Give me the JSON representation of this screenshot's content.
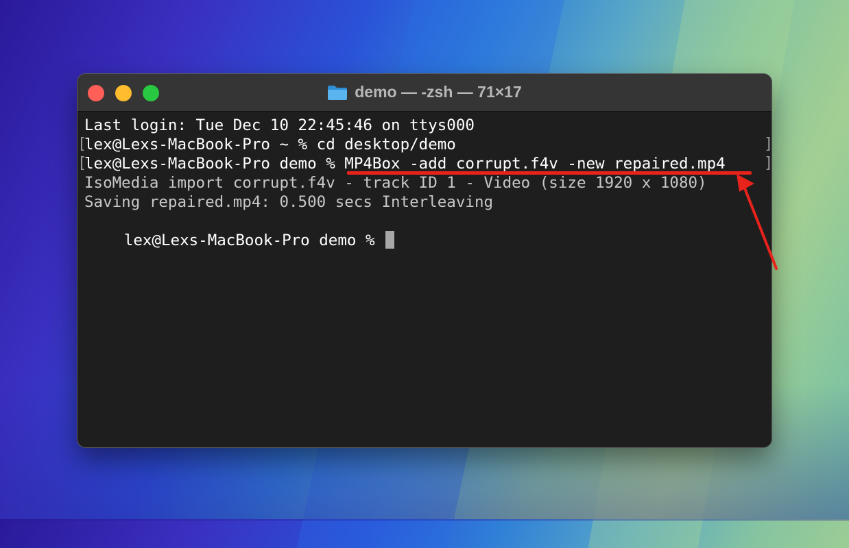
{
  "window": {
    "title": "demo — -zsh — 71×17"
  },
  "terminal": {
    "lines": [
      "Last login: Tue Dec 10 22:45:46 on ttys000",
      "lex@Lexs-MacBook-Pro ~ % cd desktop/demo",
      "lex@Lexs-MacBook-Pro demo % MP4Box -add corrupt.f4v -new repaired.mp4",
      "IsoMedia import corrupt.f4v - track ID 1 - Video (size 1920 x 1080)",
      "Saving repaired.mp4: 0.500 secs Interleaving",
      "lex@Lexs-MacBook-Pro demo % "
    ],
    "bracket_left": "[",
    "bracket_right": "]"
  },
  "colors": {
    "annotation": "#e8231b",
    "close": "#ff5f57",
    "minimize": "#febc2e",
    "maximize": "#28c840",
    "folder": "#3aa0e8"
  },
  "icons": [
    "folder-icon",
    "annotation-arrow-icon"
  ]
}
